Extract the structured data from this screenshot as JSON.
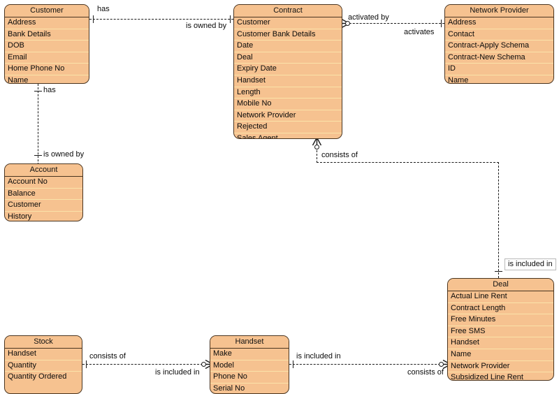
{
  "diagram": {
    "type": "entity-relationship-diagram",
    "notation": "crows-foot",
    "background_color": "#ffffff",
    "entity_fill_color": "#f6c290",
    "entity_border_color": "#4a3520",
    "row_separator_color": "#fbe3a9",
    "line_color": "#1a1a1a"
  },
  "entities": [
    {
      "id": "customer",
      "title": "Customer",
      "attributes": [
        "Address",
        "Bank Details",
        "DOB",
        "Email",
        "Home Phone No",
        "Name"
      ]
    },
    {
      "id": "contract",
      "title": "Contract",
      "attributes": [
        "Customer",
        "Customer Bank Details",
        "Date",
        "Deal",
        "Expiry Date",
        "Handset",
        "Length",
        "Mobile No",
        "Network Provider",
        "Rejected",
        "Sales Agent"
      ]
    },
    {
      "id": "network_provider",
      "title": "Network Provider",
      "attributes": [
        "Address",
        "Contact",
        "Contract-Apply Schema",
        "Contract-New Schema",
        "ID",
        "Name"
      ]
    },
    {
      "id": "account",
      "title": "Account",
      "attributes": [
        "Account No",
        "Balance",
        "Customer",
        "History"
      ]
    },
    {
      "id": "deal",
      "title": "Deal",
      "attributes": [
        "Actual Line Rent",
        "Contract Length",
        "Free Minutes",
        "Free SMS",
        "Handset",
        "Name",
        "Network Provider",
        "Subsidized Line Rent"
      ]
    },
    {
      "id": "stock",
      "title": "Stock",
      "attributes": [
        "Handset",
        "Quantity",
        "Quantity Ordered"
      ]
    },
    {
      "id": "handset",
      "title": "Handset",
      "attributes": [
        "Make",
        "Model",
        "Phone No",
        "Serial No"
      ]
    }
  ],
  "relationships": [
    {
      "id": "customer_contract",
      "from": "customer",
      "to": "contract",
      "from_label": "has",
      "to_label": "is owned by",
      "from_cardinality": "one",
      "to_cardinality": "one"
    },
    {
      "id": "customer_account",
      "from": "customer",
      "to": "account",
      "from_label": "has",
      "to_label": "is owned by",
      "from_cardinality": "one",
      "to_cardinality": "one"
    },
    {
      "id": "contract_network_provider",
      "from": "contract",
      "to": "network_provider",
      "from_label": "activated by",
      "to_label": "activates",
      "from_cardinality": "zero-or-many",
      "to_cardinality": "one"
    },
    {
      "id": "contract_deal",
      "from": "contract",
      "to": "deal",
      "from_label": "consists of",
      "to_label": "is included in",
      "from_cardinality": "zero-or-many",
      "to_cardinality": "one",
      "to_label_boxed": true
    },
    {
      "id": "stock_handset",
      "from": "stock",
      "to": "handset",
      "from_label": "consists of",
      "to_label": "is included in",
      "from_cardinality": "one",
      "to_cardinality": "zero-or-many"
    },
    {
      "id": "handset_deal",
      "from": "handset",
      "to": "deal",
      "from_label": "is included in",
      "to_label": "consists of",
      "from_cardinality": "one",
      "to_cardinality": "zero-or-many"
    }
  ]
}
